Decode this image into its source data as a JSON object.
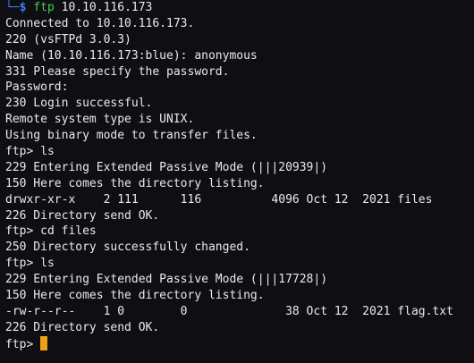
{
  "colors": {
    "background": "#0f0f13",
    "text": "#e9e9ee",
    "prompt_symbol": "#3d7df2",
    "command": "#45d04a",
    "cursor": "#f0a11b"
  },
  "prompt": {
    "tree": "└─",
    "symbol": "$",
    "command": "ftp",
    "argument": "10.10.116.173"
  },
  "lines": [
    "Connected to 10.10.116.173.",
    "220 (vsFTPd 3.0.3)",
    "Name (10.10.116.173:blue): anonymous",
    "331 Please specify the password.",
    "Password:",
    "230 Login successful.",
    "Remote system type is UNIX.",
    "Using binary mode to transfer files.",
    "ftp> ls",
    "229 Entering Extended Passive Mode (|||20939|)",
    "150 Here comes the directory listing.",
    "drwxr-xr-x    2 111      116          4096 Oct 12  2021 files",
    "226 Directory send OK.",
    "ftp> cd files",
    "250 Directory successfully changed.",
    "ftp> ls",
    "229 Entering Extended Passive Mode (|||17728|)",
    "150 Here comes the directory listing.",
    "-rw-r--r--    1 0        0              38 Oct 12  2021 flag.txt",
    "226 Directory send OK."
  ],
  "current_prompt": "ftp> ",
  "cursor_icon": "block-cursor-icon"
}
